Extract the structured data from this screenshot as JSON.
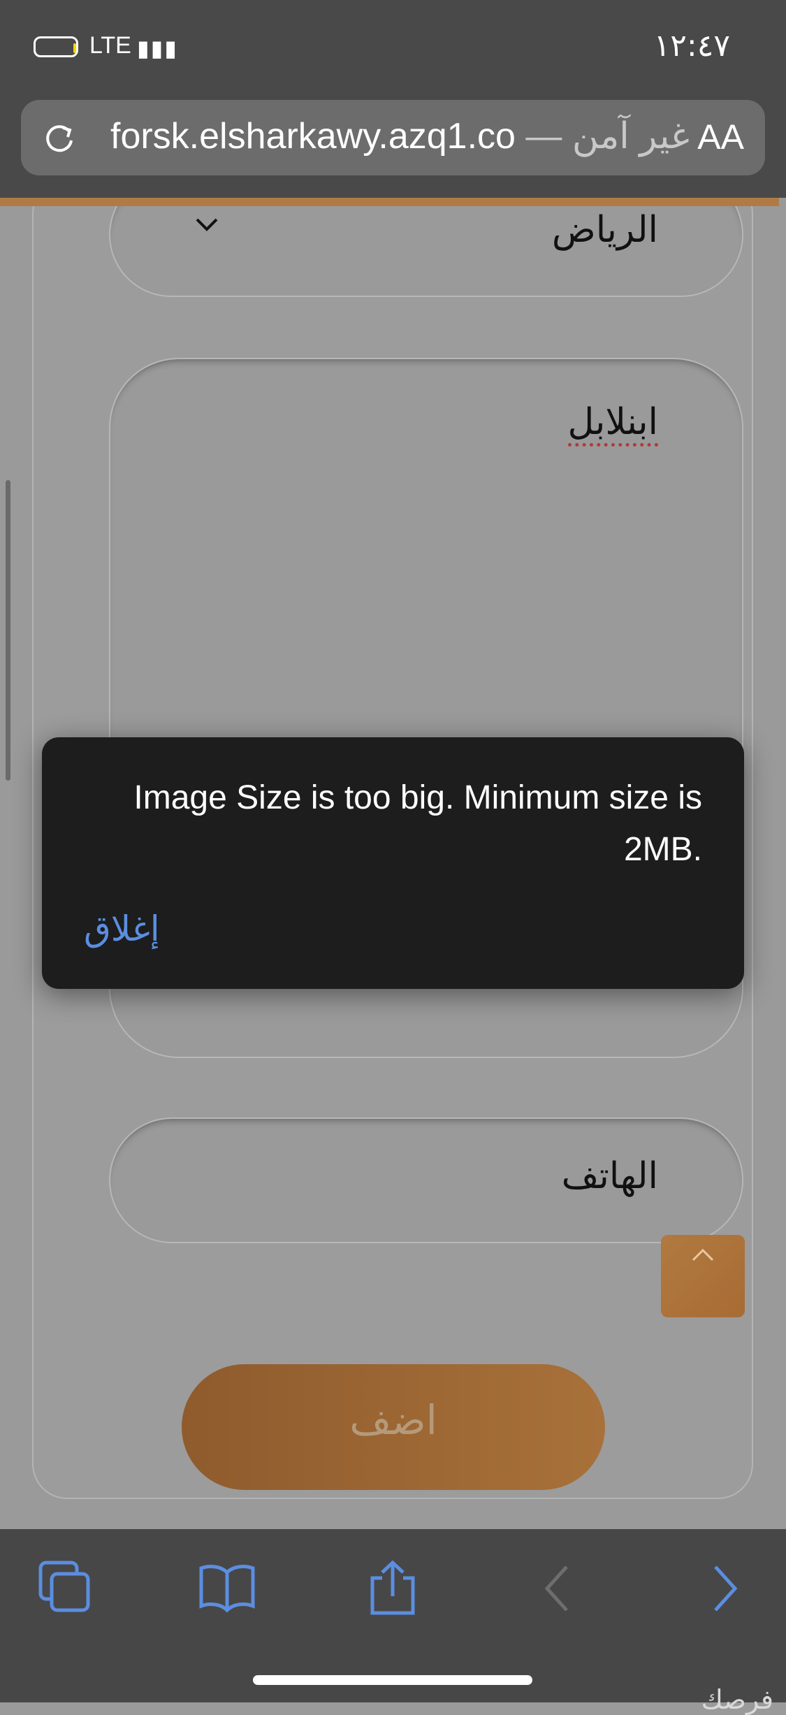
{
  "status_bar": {
    "time": "١٢:٤٧",
    "network": "LTE"
  },
  "address_bar": {
    "url": "forsk.elsharkawy.azq1.co",
    "security": "— غير آمن",
    "text_size_label": "AA"
  },
  "form": {
    "city_value": "الرياض",
    "details_value": "ابنلابل",
    "phone_placeholder": "الهاتف",
    "submit_label": "اضف"
  },
  "alert": {
    "message": "Image Size is too big. Minimum size is 2MB.",
    "close_label": "إغلاق"
  },
  "watermark": "فرصك",
  "colors": {
    "accent": "#b07a45",
    "link": "#5b8ee0",
    "alert_bg": "#1d1d1d"
  }
}
